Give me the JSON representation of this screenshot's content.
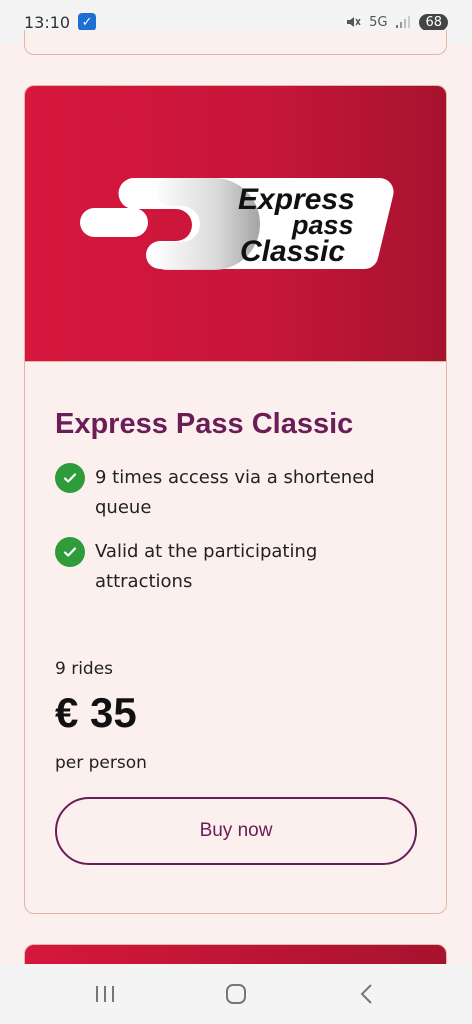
{
  "status_bar": {
    "time": "13:10",
    "network": "5G",
    "battery": "68"
  },
  "card": {
    "logo_text": [
      "Express",
      "pass",
      "Classic"
    ],
    "title": "Express Pass Classic",
    "features": [
      "9 times access via a shortened queue",
      "Valid at the participating attractions"
    ],
    "rides": "9 rides",
    "price": "€ 35",
    "per_person": "per person",
    "buy_label": "Buy now"
  },
  "colors": {
    "brand_red": "#d7173d",
    "title_purple": "#6b1d57",
    "check_green": "#2e9c3a",
    "background": "#fbf0ed"
  },
  "icons": {
    "status": [
      "checkbox-icon",
      "mute-icon",
      "5g-icon",
      "signal-icon",
      "battery-icon"
    ],
    "nav": [
      "recent-apps-icon",
      "home-icon",
      "back-icon"
    ]
  }
}
